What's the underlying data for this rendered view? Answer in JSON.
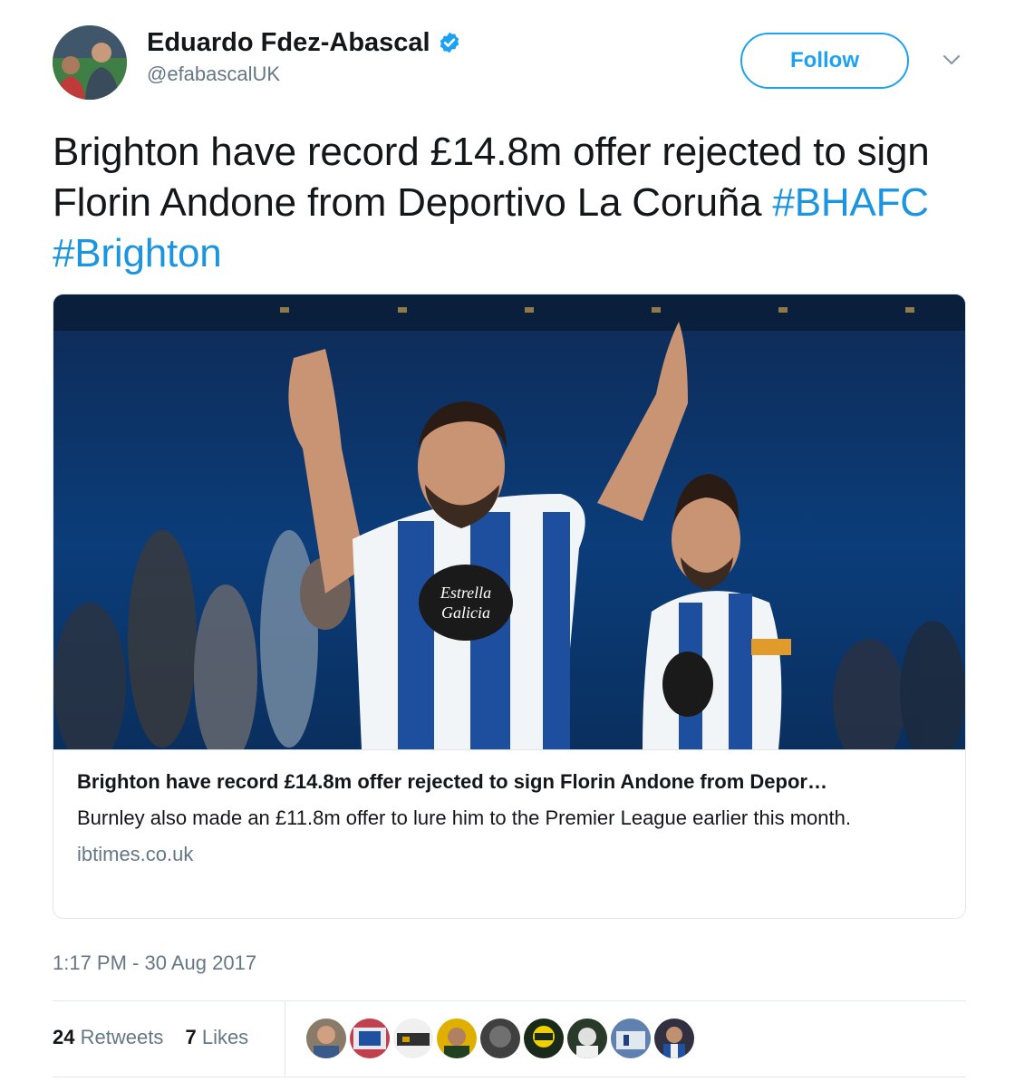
{
  "author": {
    "display_name": "Eduardo Fdez-Abascal",
    "handle": "@efabascalUK",
    "verified_icon": "verified-badge-icon",
    "follow_label": "Follow"
  },
  "tweet": {
    "text": "Brighton have record £14.8m offer rejected to sign Florin Andone from Deportivo La Coruña",
    "hashtags": [
      "#BHAFC",
      "#Brighton"
    ],
    "timestamp": "1:17 PM - 30 Aug 2017"
  },
  "card": {
    "title": "Brighton have record £14.8m offer rejected to sign Florin Andone from Depor…",
    "description": "Burnley also made an £11.8m offer to lure him to the Premier League earlier this month.",
    "domain": "ibtimes.co.uk",
    "image_text": {
      "sponsor_main": "Estrella",
      "sponsor_sub": "Galicia"
    }
  },
  "stats": {
    "retweets_count": "24",
    "retweets_label": "Retweets",
    "likes_count": "7",
    "likes_label": "Likes"
  },
  "colors": {
    "accent": "#1da1f2",
    "hashtag": "#1b95e0",
    "muted": "#657786",
    "border": "#e1e8ed",
    "text": "#14171a"
  }
}
